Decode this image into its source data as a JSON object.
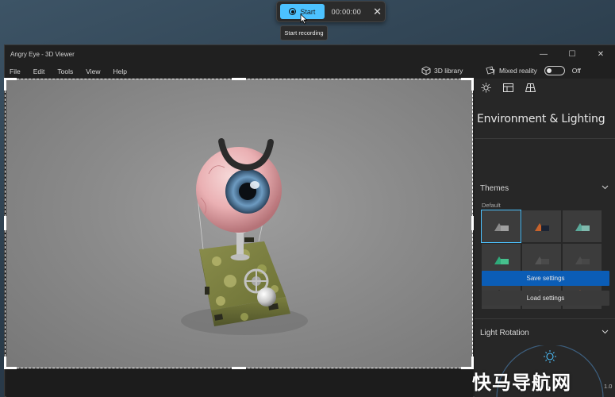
{
  "recorder": {
    "start_label": "Start",
    "timer": "00:00:00",
    "tooltip": "Start recording"
  },
  "window": {
    "title": "Angry Eye - 3D Viewer",
    "controls": {
      "minimize": "—",
      "maximize": "☐",
      "close": "✕"
    }
  },
  "menu": [
    "File",
    "Edit",
    "Tools",
    "View",
    "Help"
  ],
  "toolbar": {
    "library_label": "3D library",
    "mixed_reality_label": "Mixed reality",
    "mixed_reality_state": "Off"
  },
  "panel": {
    "title": "Environment & Lighting",
    "themes_header": "Themes",
    "default_label": "Default",
    "save_label": "Save settings",
    "load_label": "Load settings",
    "light_rotation_header": "Light Rotation",
    "light_value": "1.0"
  },
  "watermark": "快马导航网",
  "colors": {
    "accent": "#4cc2ff",
    "save_button": "#0b5db6"
  }
}
